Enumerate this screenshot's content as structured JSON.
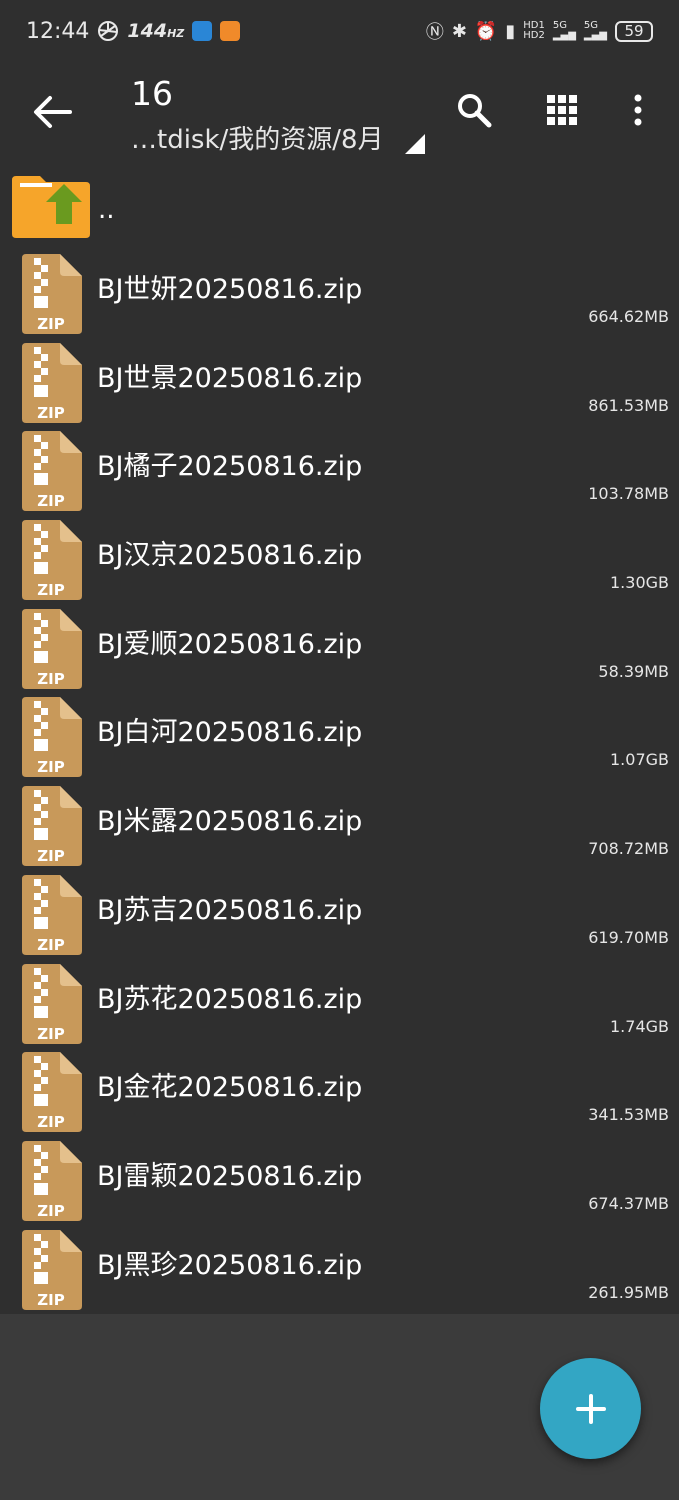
{
  "status_bar": {
    "time": "12:44",
    "refresh_rate": "144",
    "refresh_unit": "HZ",
    "network_1": "5G",
    "network_2": "5G",
    "battery": "59",
    "icons": [
      "pinwheel-icon",
      "app-blue-icon",
      "app-orange-icon",
      "nfc-icon",
      "bluetooth-icon",
      "alarm-icon",
      "vibrate-icon",
      "hd-icon",
      "signal-icon"
    ]
  },
  "toolbar": {
    "title": "16",
    "path": "…tdisk/我的资源/8月",
    "icons": [
      "back-arrow-icon",
      "search-icon",
      "grid-view-icon",
      "more-vert-icon"
    ]
  },
  "parent_item": {
    "label": ".."
  },
  "files": [
    {
      "name": "BJ世妍20250816.zip",
      "size": "664.62MB"
    },
    {
      "name": "BJ世景20250816.zip",
      "size": "861.53MB"
    },
    {
      "name": "BJ橘子20250816.zip",
      "size": "103.78MB"
    },
    {
      "name": "BJ汉京20250816.zip",
      "size": "1.30GB"
    },
    {
      "name": "BJ爱顺20250816.zip",
      "size": "58.39MB"
    },
    {
      "name": "BJ白河20250816.zip",
      "size": "1.07GB"
    },
    {
      "name": "BJ米露20250816.zip",
      "size": "708.72MB"
    },
    {
      "name": "BJ苏吉20250816.zip",
      "size": "619.70MB"
    },
    {
      "name": "BJ苏花20250816.zip",
      "size": "1.74GB"
    },
    {
      "name": "BJ金花20250816.zip",
      "size": "341.53MB"
    },
    {
      "name": "BJ雷颖20250816.zip",
      "size": "674.37MB"
    },
    {
      "name": "BJ黑珍20250816.zip",
      "size": "261.95MB"
    }
  ],
  "zip_icon_label": "ZIP",
  "fab": {
    "icon": "plus-icon"
  },
  "colors": {
    "background": "#2f2f2f",
    "fab": "#33a6c4",
    "zip_icon": "#c8995a",
    "folder": "#f6a52a",
    "folder_arrow": "#6a9a1f"
  }
}
